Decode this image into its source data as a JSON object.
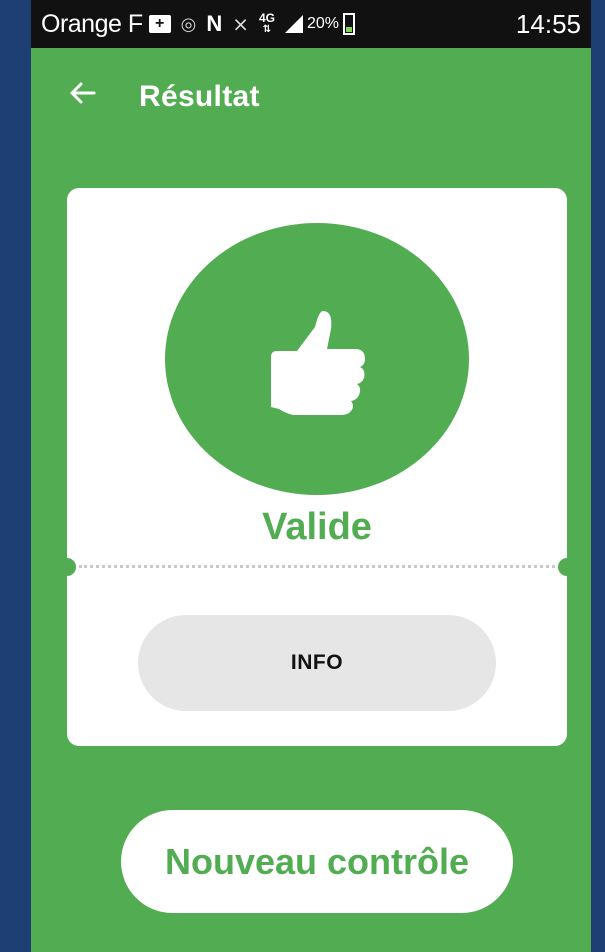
{
  "status_bar": {
    "carrier": "Orange F",
    "network": "4G",
    "battery": "20%",
    "time": "14:55",
    "icons": [
      "notification-icon",
      "eye-icon",
      "nfc-icon",
      "mute-icon",
      "network-4g-icon",
      "signal-icon",
      "battery-charging-icon"
    ]
  },
  "app_bar": {
    "title": "Résultat",
    "back_icon": "arrow-left-icon"
  },
  "result": {
    "icon": "thumbs-up-icon",
    "status": "Valide"
  },
  "buttons": {
    "info": "INFO",
    "new_check": "Nouveau contrôle"
  },
  "colors": {
    "primary": "#52ad52",
    "status_bar": "#111111",
    "outer_background": "#1e3f73",
    "card": "#ffffff",
    "info_button": "#e6e6e6"
  }
}
